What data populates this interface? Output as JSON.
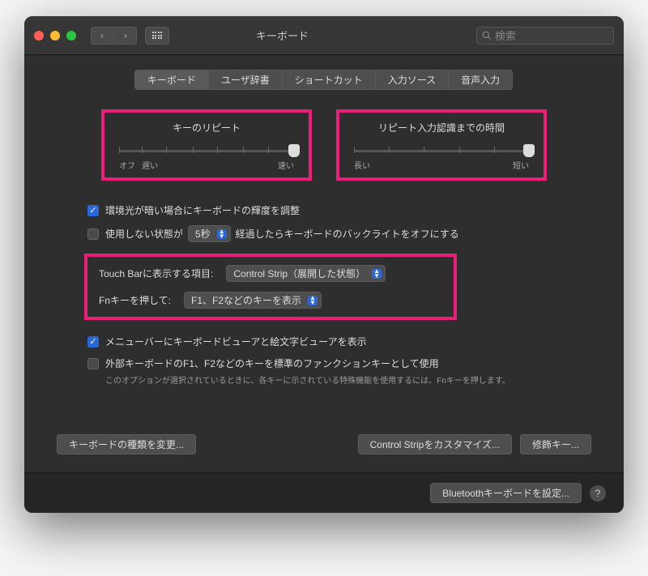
{
  "window": {
    "title": "キーボード"
  },
  "search": {
    "placeholder": "検索"
  },
  "tabs": [
    "キーボード",
    "ユーザ辞書",
    "ショートカット",
    "入力ソース",
    "音声入力"
  ],
  "sliders": {
    "repeat": {
      "title": "キーのリピート",
      "left1": "オフ",
      "left2": "遅い",
      "right": "速い"
    },
    "delay": {
      "title": "リピート入力認識までの時間",
      "left": "長い",
      "right": "短い"
    }
  },
  "checks": {
    "brightness": "環境光が暗い場合にキーボードの輝度を調整",
    "idle_prefix": "使用しない状態が",
    "idle_select": "5秒",
    "idle_suffix": "経過したらキーボードのバックライトをオフにする",
    "touchbar_label": "Touch Barに表示する項目:",
    "touchbar_select": "Control Strip（展開した状態）",
    "fn_label": "Fnキーを押して:",
    "fn_select": "F1、F2などのキーを表示",
    "viewer": "メニューバーにキーボードビューアと絵文字ビューアを表示",
    "fnkeys": "外部キーボードのF1、F2などのキーを標準のファンクションキーとして使用",
    "fnkeys_note": "このオプションが選択されているときに、各キーに示されている特殊機能を使用するには、Fnキーを押します。"
  },
  "buttons": {
    "keyboard_type": "キーボードの種類を変更...",
    "customize": "Control Stripをカスタマイズ...",
    "modifier": "修飾キー...",
    "bluetooth": "Bluetoothキーボードを設定..."
  }
}
